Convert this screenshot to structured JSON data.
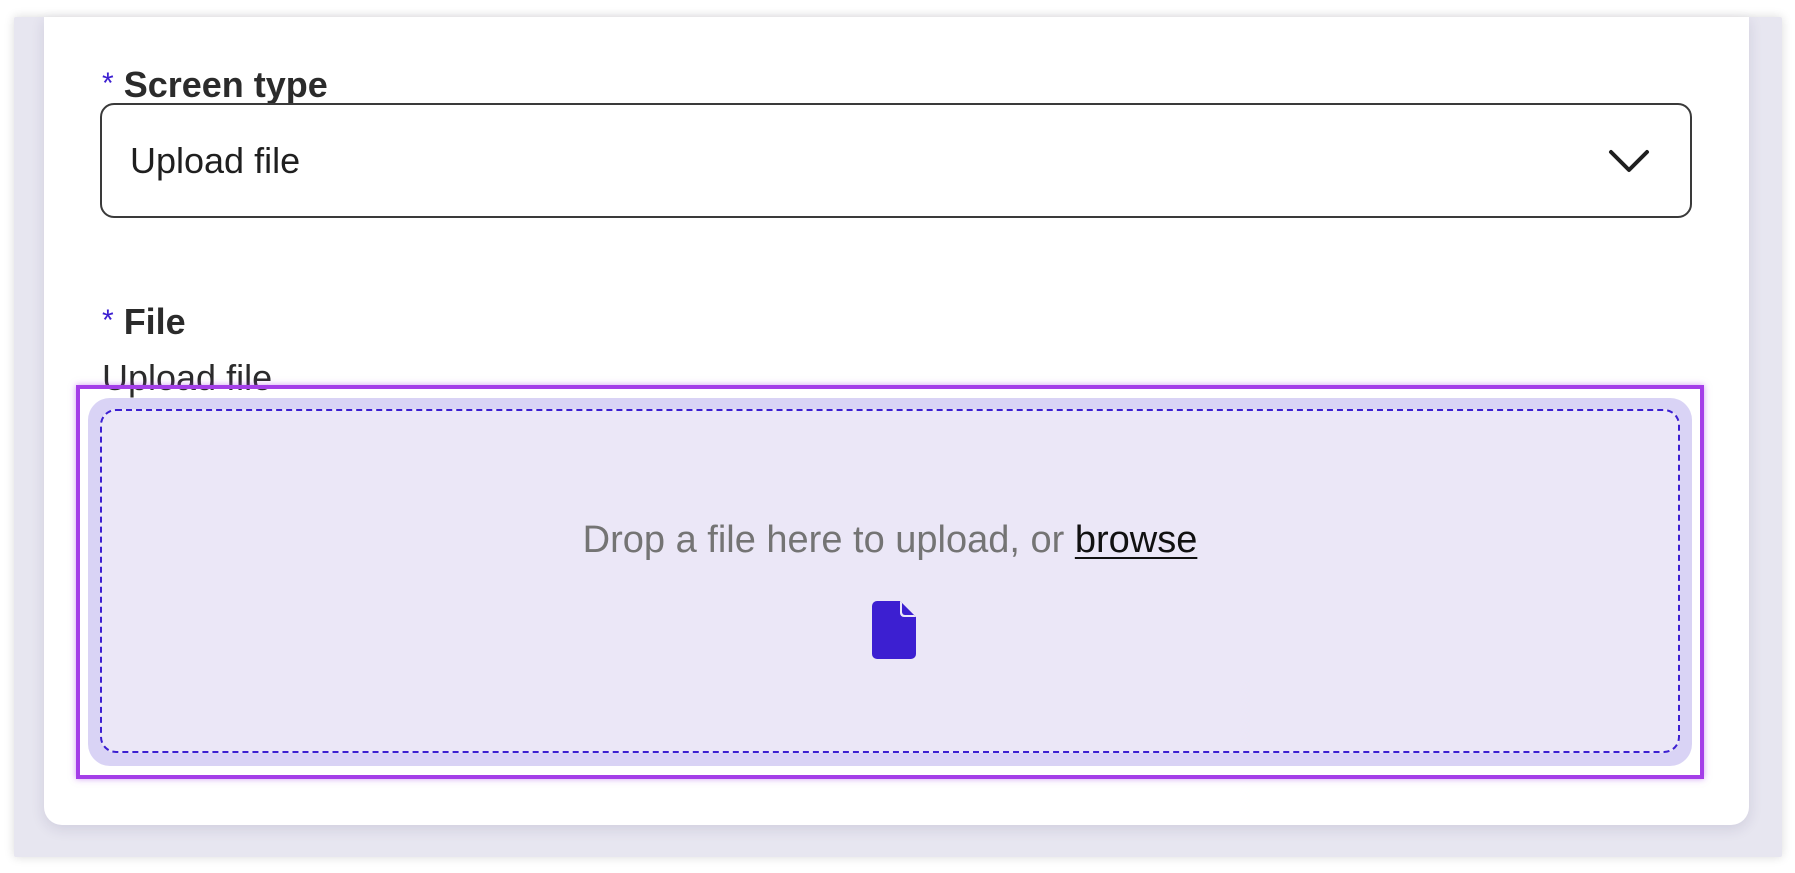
{
  "form": {
    "screen_type": {
      "label": "Screen type",
      "required_mark": "*",
      "selected_value": "Upload file",
      "icon": "chevron-down-icon"
    },
    "file": {
      "label": "File",
      "required_mark": "*",
      "helper_text": "Upload file",
      "dropzone": {
        "text": "Drop a file here to upload, or",
        "browse_label": "browse",
        "icon": "file-icon"
      }
    }
  },
  "colors": {
    "accent": "#3c1fd1",
    "focus_ring": "#a43ee8",
    "dropzone_bg": "#ebe7f7",
    "dropzone_outer": "#d9d3f5",
    "text": "#2b2b2b",
    "muted_text": "#747474"
  }
}
